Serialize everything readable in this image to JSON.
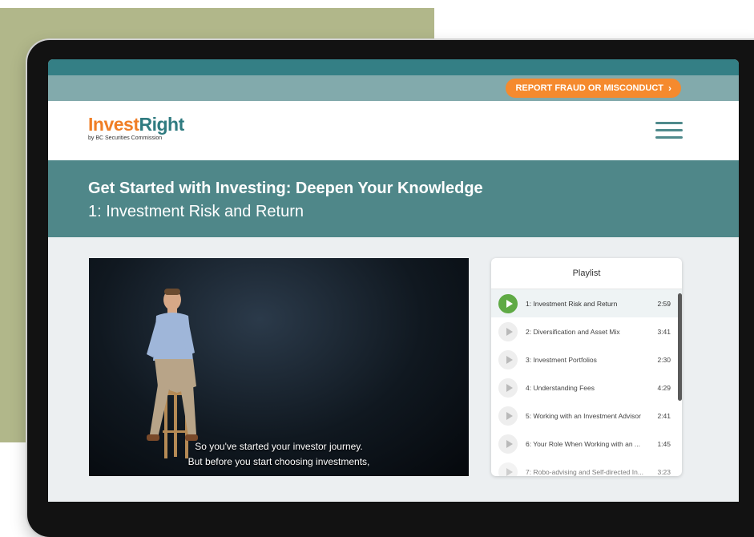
{
  "utility_bar": {
    "report_label": "REPORT FRAUD OR MISCONDUCT",
    "report_chevron": "›"
  },
  "header": {
    "logo_invest": "Invest",
    "logo_right": "Right",
    "logo_subtitle": "by BC Securities Commission"
  },
  "hero": {
    "title": "Get Started with Investing: Deepen Your Knowledge",
    "subtitle": "1: Investment Risk and Return"
  },
  "video": {
    "caption_line_1": "So you've started your investor journey.",
    "caption_line_2": "But before you start choosing investments,"
  },
  "playlist": {
    "title": "Playlist",
    "items": [
      {
        "label": "1: Investment Risk and Return",
        "duration": "2:59"
      },
      {
        "label": "2: Diversification and Asset Mix",
        "duration": "3:41"
      },
      {
        "label": "3: Investment Portfolios",
        "duration": "2:30"
      },
      {
        "label": "4: Understanding Fees",
        "duration": "4:29"
      },
      {
        "label": "5: Working with an Investment Advisor",
        "duration": "2:41"
      },
      {
        "label": "6: Your Role When Working with an ...",
        "duration": "1:45"
      },
      {
        "label": "7: Robo-advising and Self-directed In...",
        "duration": "3:23"
      }
    ]
  },
  "colors": {
    "brand_orange": "#f58a2e",
    "brand_teal": "#4f8789",
    "active_green": "#5faa45"
  }
}
